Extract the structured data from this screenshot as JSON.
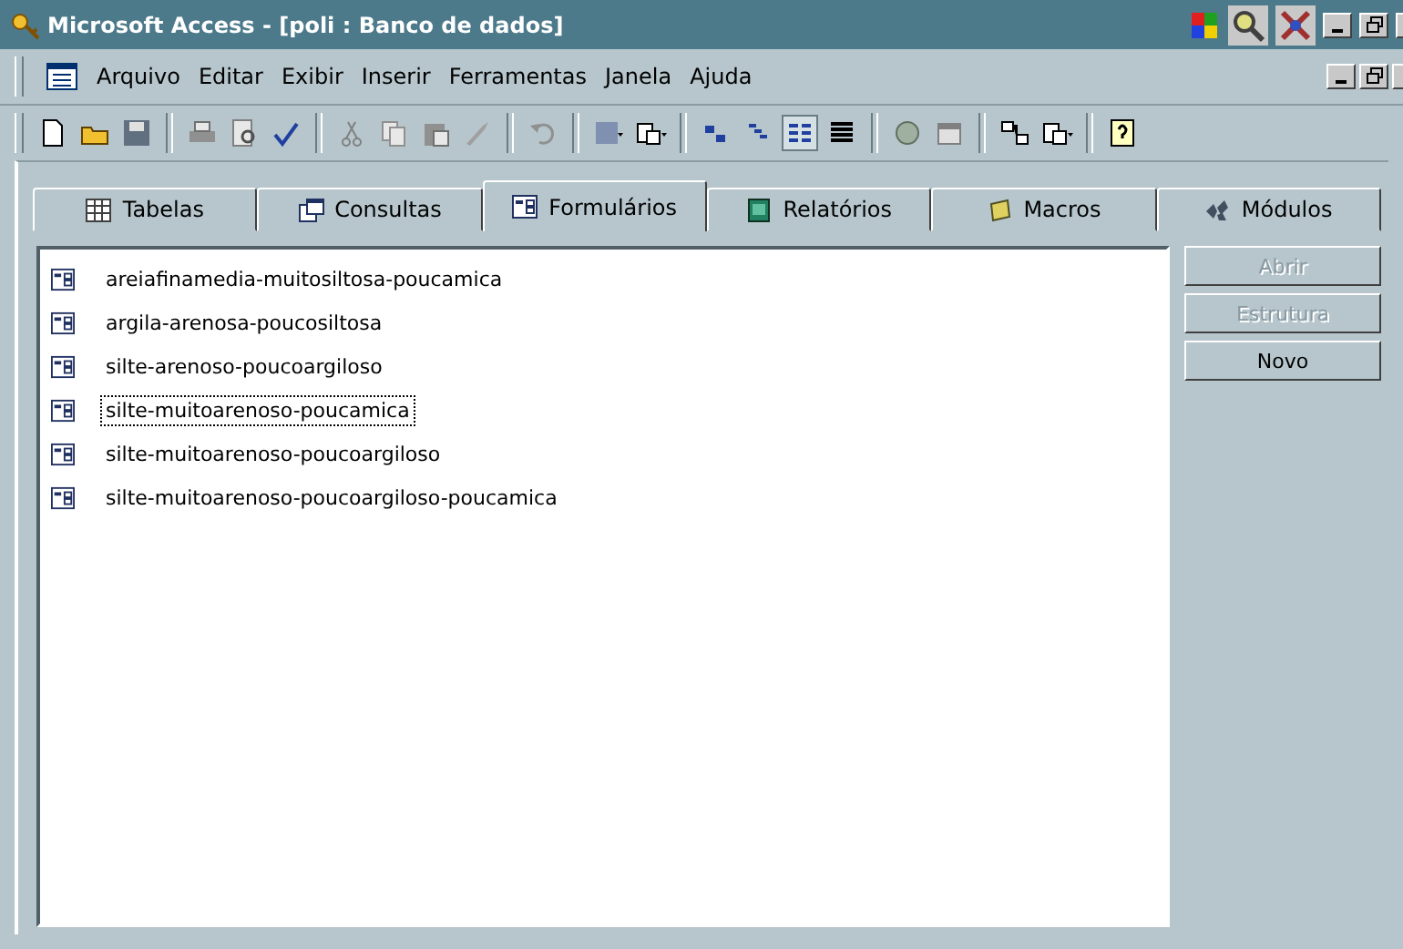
{
  "window": {
    "title": "Microsoft Access - [poli : Banco de dados]"
  },
  "menu": [
    "Arquivo",
    "Editar",
    "Exibir",
    "Inserir",
    "Ferramentas",
    "Janela",
    "Ajuda"
  ],
  "tabs": [
    {
      "label": "Tabelas",
      "selected": false
    },
    {
      "label": "Consultas",
      "selected": false
    },
    {
      "label": "Formulários",
      "selected": true
    },
    {
      "label": "Relatórios",
      "selected": false
    },
    {
      "label": "Macros",
      "selected": false
    },
    {
      "label": "Módulos",
      "selected": false
    }
  ],
  "items": [
    {
      "name": "areiafinamedia-muitosiltosa-poucamica",
      "selected": false
    },
    {
      "name": "argila-arenosa-poucosiltosa",
      "selected": false
    },
    {
      "name": "silte-arenoso-poucoargiloso",
      "selected": false
    },
    {
      "name": "silte-muitoarenoso-poucamica",
      "selected": true
    },
    {
      "name": "silte-muitoarenoso-poucoargiloso",
      "selected": false
    },
    {
      "name": "silte-muitoarenoso-poucoargiloso-poucamica",
      "selected": false
    }
  ],
  "buttons": [
    {
      "label": "Abrir",
      "disabled": true
    },
    {
      "label": "Estrutura",
      "disabled": true
    },
    {
      "label": "Novo",
      "disabled": false
    }
  ]
}
